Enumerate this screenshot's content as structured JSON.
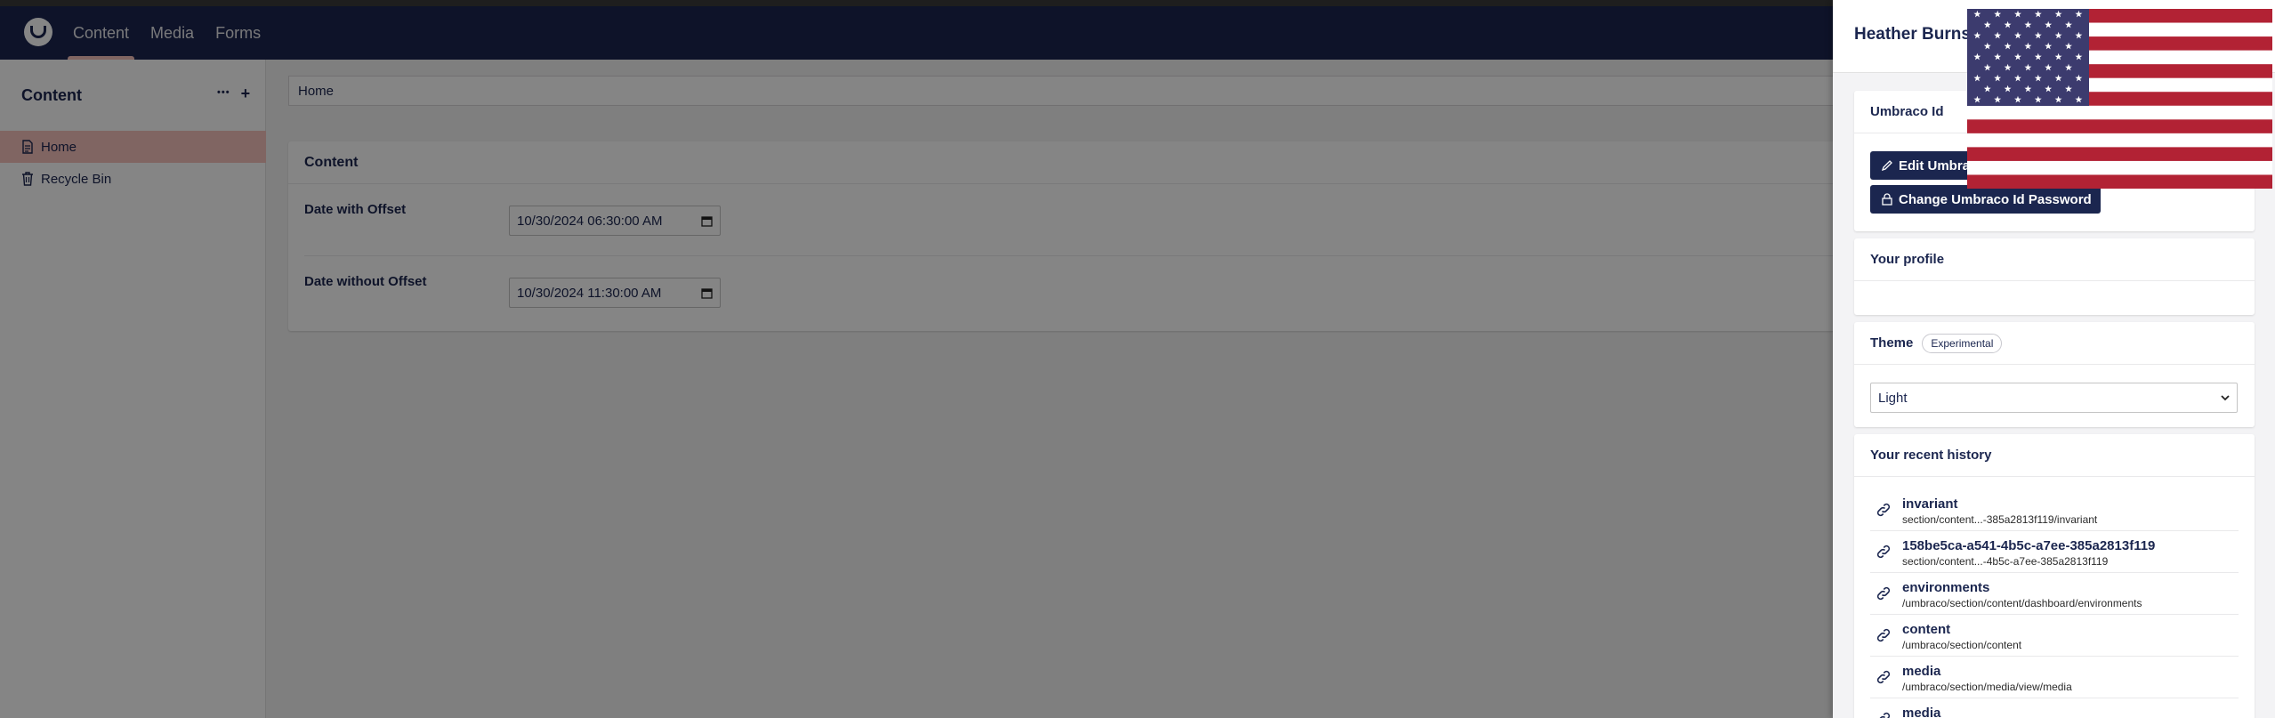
{
  "header": {
    "nav": [
      "Content",
      "Media",
      "Forms"
    ]
  },
  "sidebar": {
    "title": "Content",
    "more": "•••",
    "add": "+",
    "items": [
      {
        "label": "Home"
      },
      {
        "label": "Recycle Bin"
      }
    ]
  },
  "main": {
    "breadcrumb": "Home",
    "card_title": "Content",
    "properties": [
      {
        "label": "Date with Offset",
        "value": "10/30/2024 06:30:00 AM"
      },
      {
        "label": "Date without Offset",
        "value": "10/30/2024 11:30:00 AM"
      }
    ]
  },
  "panel": {
    "user_name": "Heather Burns",
    "umbraco_id": {
      "title": "Umbraco Id",
      "edit_label": "Edit Umbraco Id",
      "change_password_label": "Change Umbraco Id Password"
    },
    "profile_title": "Your profile",
    "theme": {
      "title": "Theme",
      "badge": "Experimental",
      "selected": "Light"
    },
    "history": {
      "title": "Your recent history",
      "items": [
        {
          "title": "invariant",
          "path": "section/content...-385a2813f119/invariant"
        },
        {
          "title": "158be5ca-a541-4b5c-a7ee-385a2813f119",
          "path": "section/content...-4b5c-a7ee-385a2813f119"
        },
        {
          "title": "environments",
          "path": "/umbraco/section/content/dashboard/environments"
        },
        {
          "title": "content",
          "path": "/umbraco/section/content"
        },
        {
          "title": "media",
          "path": "/umbraco/section/media/view/media"
        },
        {
          "title": "media",
          "path": ""
        }
      ]
    }
  },
  "colors": {
    "header_bg": "#1b264f",
    "active_accent": "#f5c1bc",
    "flag_red": "#b22234",
    "flag_blue": "#3c3b6e"
  }
}
